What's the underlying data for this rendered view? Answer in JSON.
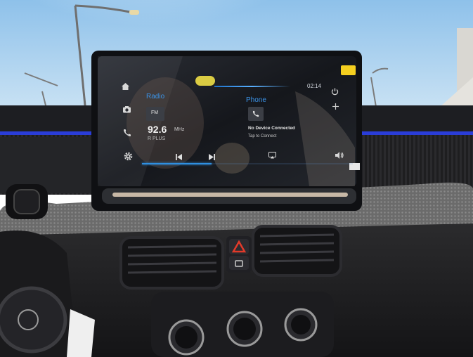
{
  "status": {
    "time": "02:14"
  },
  "radio": {
    "title": "Radio",
    "band": "FM",
    "frequency": "92.6",
    "unit": "MHz",
    "station": "R PLUS",
    "progress": 0.33
  },
  "phone": {
    "title": "Phone",
    "status": "No Device Connected",
    "action": "Tap to Connect"
  },
  "colors": {
    "accent": "#2f8fe0",
    "sky": "#9fcbeb",
    "dash_accent": "#2a3dd8",
    "hazard": "#e23a2a",
    "tag": "#f5cf1f"
  }
}
